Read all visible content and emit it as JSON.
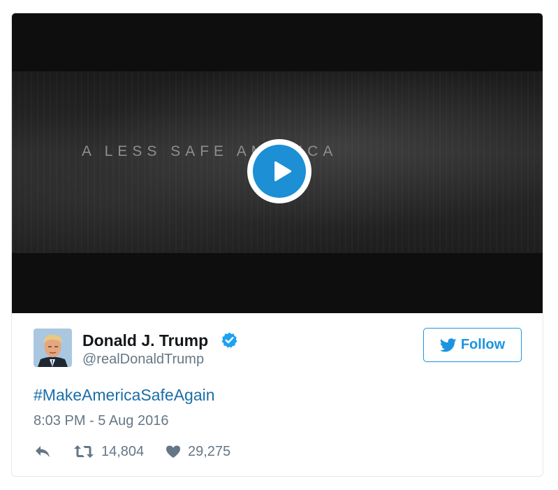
{
  "video": {
    "caption": "A LESS SAFE AMERICA",
    "play_icon": "play-icon"
  },
  "tweet": {
    "author": {
      "name": "Donald J. Trump",
      "handle": "@realDonaldTrump",
      "verified": true,
      "avatar_icon": "avatar"
    },
    "follow_label": "Follow",
    "text": "#MakeAmericaSafeAgain",
    "timestamp": "8:03 PM - 5 Aug 2016",
    "stats": {
      "retweets": "14,804",
      "likes": "29,275"
    }
  },
  "colors": {
    "accent": "#1b95e0",
    "hashtag": "#1b6ea6",
    "muted": "#657786",
    "name": "#14171a",
    "play": "#1d8fd4"
  }
}
